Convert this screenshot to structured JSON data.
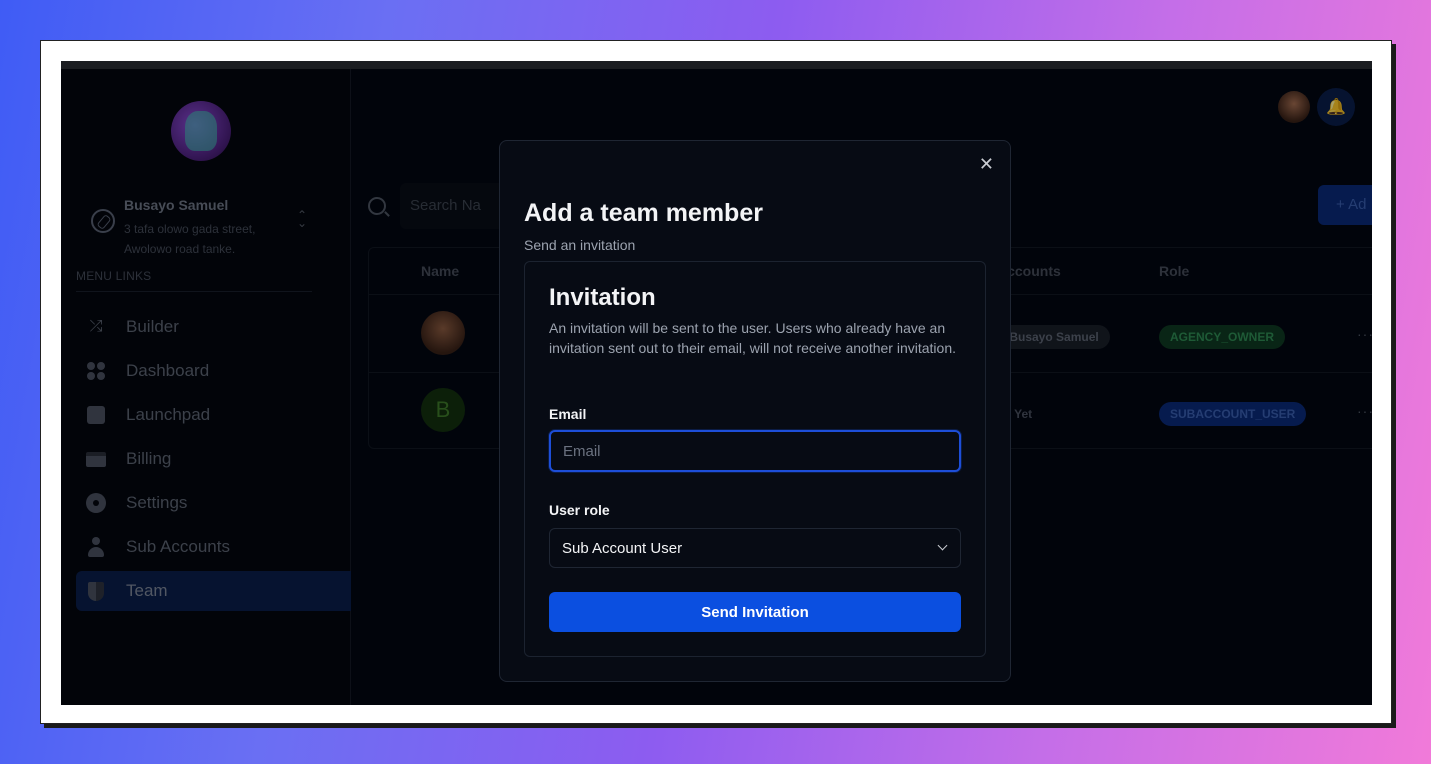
{
  "sidebar": {
    "account_name": "Busayo Samuel",
    "account_address": "3 tafa olowo gada street, Awolowo road tanke.",
    "menu_title": "MENU LINKS",
    "items": [
      {
        "label": "Builder",
        "icon": "shuffle-icon"
      },
      {
        "label": "Dashboard",
        "icon": "dashboard-icon"
      },
      {
        "label": "Launchpad",
        "icon": "clipboard-icon"
      },
      {
        "label": "Billing",
        "icon": "credit-card-icon"
      },
      {
        "label": "Settings",
        "icon": "gear-icon"
      },
      {
        "label": "Sub Accounts",
        "icon": "person-icon"
      },
      {
        "label": "Team",
        "icon": "shield-icon"
      }
    ],
    "active_item": "Team"
  },
  "main": {
    "search_placeholder": "Search Na",
    "add_button_label": "+ Ad",
    "table": {
      "headers": [
        "Name",
        "Accounts",
        "Role"
      ],
      "rows": [
        {
          "avatar_initial": "",
          "accounts": "y - Busayo Samuel",
          "role": "AGENCY_OWNER"
        },
        {
          "avatar_initial": "B",
          "accounts": "ess Yet",
          "role": "SUBACCOUNT_USER"
        }
      ]
    }
  },
  "modal": {
    "title": "Add a team member",
    "subtitle": "Send an invitation",
    "card_title": "Invitation",
    "card_description": "An invitation will be sent to the user. Users who already have an invitation sent out to their email, will not receive another invitation.",
    "email_label": "Email",
    "email_placeholder": "Email",
    "email_value": "",
    "role_label": "User role",
    "role_value": "Sub Account User",
    "submit_label": "Send Invitation"
  },
  "colors": {
    "accent": "#0b4fe0",
    "agency_owner_badge": "#0e3a22",
    "subaccount_badge": "#0a2a78"
  }
}
